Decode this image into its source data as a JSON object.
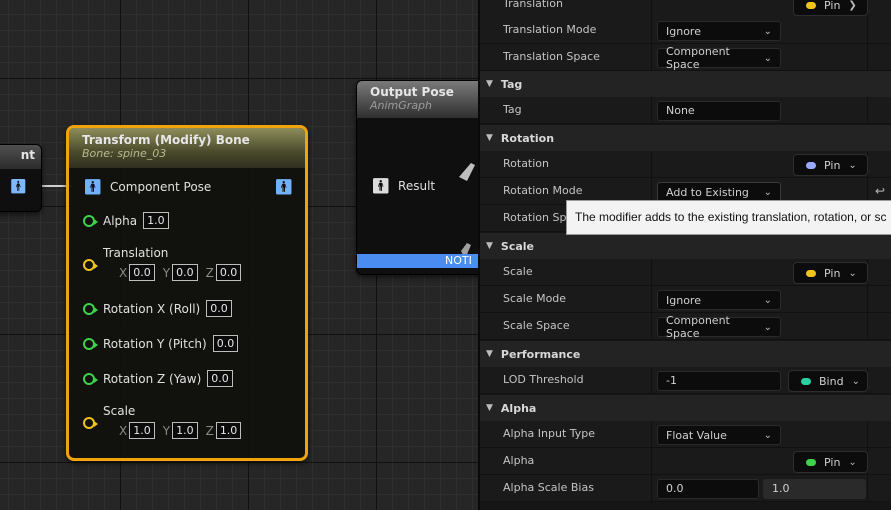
{
  "graph": {
    "left_node": {
      "title_fragment": "nt"
    },
    "transform_node": {
      "title": "Transform (Modify) Bone",
      "subtitle": "Bone: spine_03",
      "component_pose_label": "Component Pose",
      "alpha_label": "Alpha",
      "alpha_value": "1.0",
      "translation_label": "Translation",
      "translation": {
        "x": "0.0",
        "y": "0.0",
        "z": "0.0"
      },
      "rotation_x_label": "Rotation X (Roll)",
      "rotation_x_value": "0.0",
      "rotation_y_label": "Rotation Y (Pitch)",
      "rotation_y_value": "0.0",
      "rotation_z_label": "Rotation Z (Yaw)",
      "rotation_z_value": "0.0",
      "scale_label": "Scale",
      "scale": {
        "x": "1.0",
        "y": "1.0",
        "z": "1.0"
      },
      "axis_labels": {
        "x": "X",
        "y": "Y",
        "z": "Z"
      }
    },
    "output_node": {
      "title": "Output Pose",
      "subtitle": "AnimGraph",
      "result_label": "Result",
      "notify_fragment": "NOTI"
    }
  },
  "details": {
    "rows_top": {
      "translation": {
        "label": "Translation",
        "pin": "Pin"
      },
      "translation_mode": {
        "label": "Translation Mode",
        "value": "Ignore"
      },
      "translation_space": {
        "label": "Translation Space",
        "value": "Component Space"
      }
    },
    "tag_section": {
      "title": "Tag",
      "tag_label": "Tag",
      "tag_value": "None"
    },
    "rotation_section": {
      "title": "Rotation",
      "rotation": {
        "label": "Rotation",
        "pin": "Pin"
      },
      "rotation_mode": {
        "label": "Rotation Mode",
        "value": "Add to Existing"
      },
      "rotation_space": {
        "label": "Rotation Space"
      }
    },
    "scale_section": {
      "title": "Scale",
      "scale": {
        "label": "Scale",
        "pin": "Pin"
      },
      "scale_mode": {
        "label": "Scale Mode",
        "value": "Ignore"
      },
      "scale_space": {
        "label": "Scale Space",
        "value": "Component Space"
      }
    },
    "performance_section": {
      "title": "Performance",
      "lod_threshold": {
        "label": "LOD Threshold",
        "value": "-1",
        "bind": "Bind"
      }
    },
    "alpha_section": {
      "title": "Alpha",
      "alpha_input_type": {
        "label": "Alpha Input Type",
        "value": "Float Value"
      },
      "alpha": {
        "label": "Alpha",
        "pin": "Pin"
      },
      "alpha_scale_bias": {
        "label": "Alpha Scale Bias",
        "min": "0.0",
        "max": "1.0"
      }
    },
    "tooltip": "The modifier adds to the existing translation, rotation, or sc"
  },
  "colors": {
    "accent_orange": "#f0a30a",
    "pin_yellow": "#f0c419",
    "pin_blue": "#9aa7ff",
    "pin_green": "#3fd24a",
    "bind_teal": "#2bd0a0",
    "notify_blue": "#4a8cf0"
  },
  "icons": {
    "pose_pin": "person-icon",
    "collapse": "chevron-down-icon",
    "reset": "reset-arrow-icon"
  }
}
